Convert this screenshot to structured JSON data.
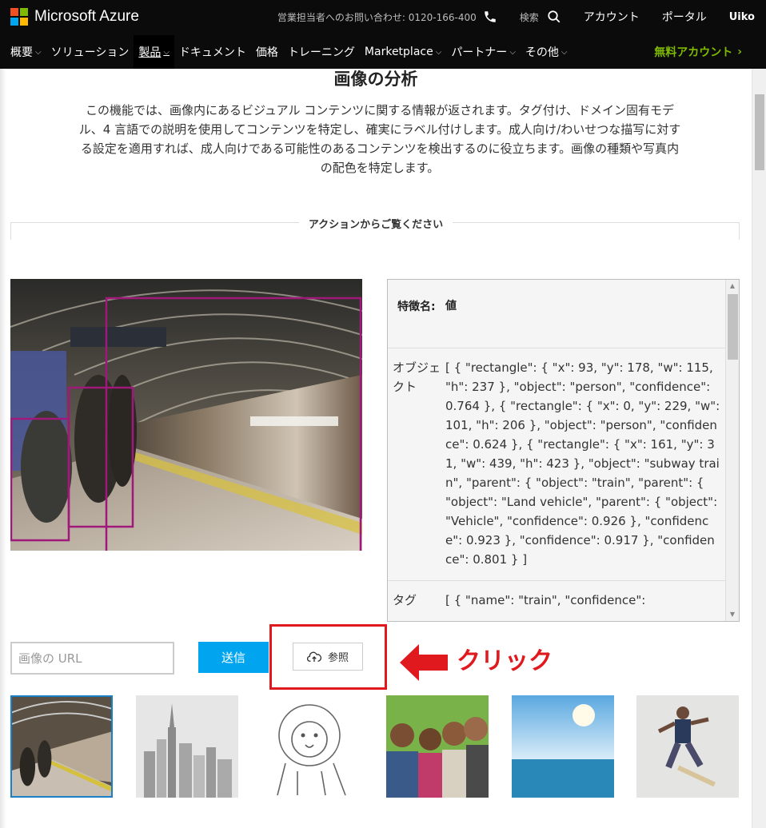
{
  "header": {
    "brand": "Microsoft Azure",
    "contact": "営業担当者へのお問い合わせ: 0120-166-400",
    "search_label": "検索",
    "account": "アカウント",
    "portal": "ポータル",
    "user": "Uiko"
  },
  "nav": {
    "items": [
      "概要",
      "ソリューション",
      "製品",
      "ドキュメント",
      "価格",
      "トレーニング",
      "Marketplace",
      "パートナー",
      "その他"
    ],
    "free_account": "無料アカウント"
  },
  "page": {
    "title": "画像の分析",
    "description": "この機能では、画像内にあるビジュアル コンテンツに関する情報が返されます。タグ付け、ドメイン固有モデル、4 言語での説明を使用してコンテンツを特定し、確実にラベル付けします。成人向け/わいせつな描写に対する設定を適用すれば、成人向けである可能性のあるコンテンツを検出するのに役立ちます。画像の種類や写真内の配色を特定します。",
    "section_label": "アクションからご覧ください"
  },
  "results": {
    "header_feature": "特徴名:",
    "header_value": "値",
    "rows": [
      {
        "name": "オブジェクト",
        "value": "[ { \"rectangle\": { \"x\": 93, \"y\": 178, \"w\": 115, \"h\": 237 }, \"object\": \"person\", \"confidence\": 0.764 }, { \"rectangle\": { \"x\": 0, \"y\": 229, \"w\": 101, \"h\": 206 }, \"object\": \"person\", \"confidence\": 0.624 }, { \"rectangle\": { \"x\": 161, \"y\": 31, \"w\": 439, \"h\": 423 }, \"object\": \"subway train\", \"parent\": { \"object\": \"train\", \"parent\": { \"object\": \"Land vehicle\", \"parent\": { \"object\": \"Vehicle\", \"confidence\": 0.926 }, \"confidence\": 0.923 }, \"confidence\": 0.917 }, \"confidence\": 0.801 } ]"
      },
      {
        "name": "タグ",
        "value": "[ { \"name\": \"train\", \"confidence\":"
      }
    ]
  },
  "controls": {
    "url_placeholder": "画像の URL",
    "submit_label": "送信",
    "browse_label": "参照",
    "annotation": "クリック"
  },
  "colors": {
    "accent": "#00a4ef",
    "annotation_red": "#e0191f",
    "detection_box": "#a0187a",
    "free_account_green": "#7fba00"
  }
}
